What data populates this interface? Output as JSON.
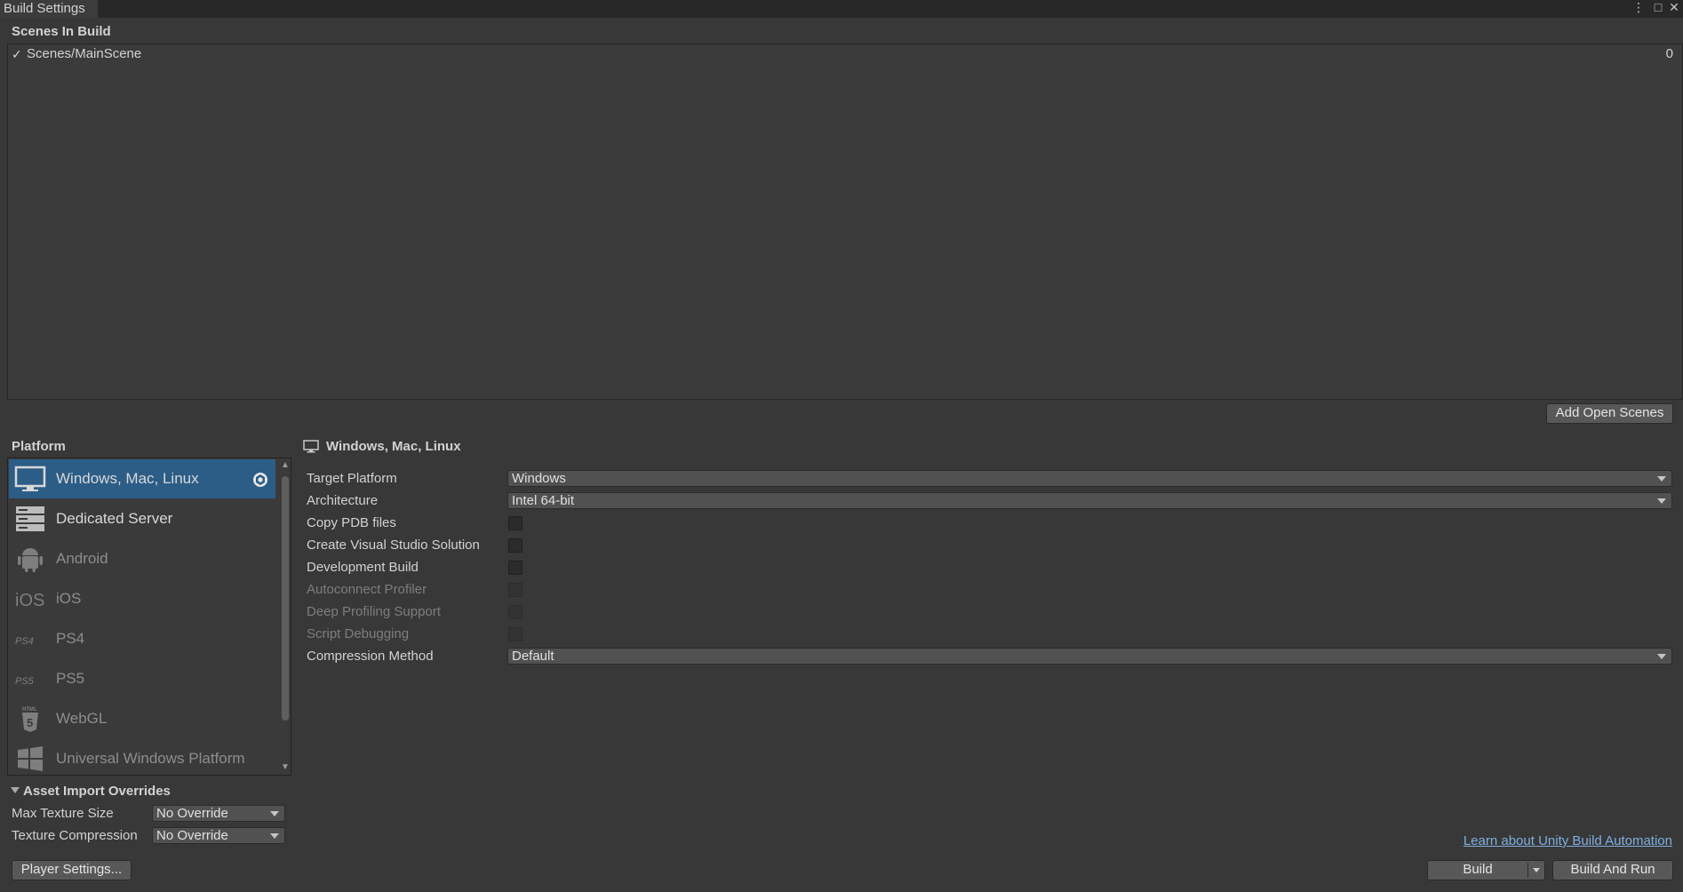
{
  "window": {
    "tab_title": "Build Settings",
    "more_icon": "⋮",
    "maximize_icon": "□",
    "close_icon": "✕"
  },
  "scenes": {
    "header": "Scenes In Build",
    "items": [
      {
        "checked": true,
        "name": "Scenes/MainScene",
        "index": "0"
      }
    ],
    "add_open_scenes_label": "Add Open Scenes"
  },
  "platform": {
    "header": "Platform",
    "items": [
      {
        "label": "Windows, Mac, Linux",
        "icon": "monitor-icon",
        "selected": true,
        "enabled": true
      },
      {
        "label": "Dedicated Server",
        "icon": "server-icon",
        "selected": false,
        "enabled": true
      },
      {
        "label": "Android",
        "icon": "android-icon",
        "selected": false,
        "enabled": false
      },
      {
        "label": "iOS",
        "icon": "ios-icon",
        "selected": false,
        "enabled": false
      },
      {
        "label": "PS4",
        "icon": "ps4-icon",
        "selected": false,
        "enabled": false
      },
      {
        "label": "PS5",
        "icon": "ps5-icon",
        "selected": false,
        "enabled": false
      },
      {
        "label": "WebGL",
        "icon": "html5-icon",
        "selected": false,
        "enabled": false
      },
      {
        "label": "Universal Windows Platform",
        "icon": "windows-icon",
        "selected": false,
        "enabled": false
      }
    ]
  },
  "settings": {
    "header": "Windows, Mac, Linux",
    "target_platform": {
      "label": "Target Platform",
      "value": "Windows"
    },
    "architecture": {
      "label": "Architecture",
      "value": "Intel 64-bit"
    },
    "copy_pdb": {
      "label": "Copy PDB files",
      "checked": false
    },
    "create_vs": {
      "label": "Create Visual Studio Solution",
      "checked": false
    },
    "dev_build": {
      "label": "Development Build",
      "checked": false
    },
    "autoconnect": {
      "label": "Autoconnect Profiler",
      "checked": false
    },
    "deep_profiling": {
      "label": "Deep Profiling Support",
      "checked": false
    },
    "script_debugging": {
      "label": "Script Debugging",
      "checked": false
    },
    "compression": {
      "label": "Compression Method",
      "value": "Default"
    }
  },
  "overrides": {
    "header": "Asset Import Overrides",
    "max_texture": {
      "label": "Max Texture Size",
      "value": "No Override"
    },
    "texture_compression": {
      "label": "Texture Compression",
      "value": "No Override"
    }
  },
  "footer": {
    "player_settings": "Player Settings...",
    "learn_link": "Learn about Unity Build Automation",
    "build": "Build",
    "build_and_run": "Build And Run"
  }
}
